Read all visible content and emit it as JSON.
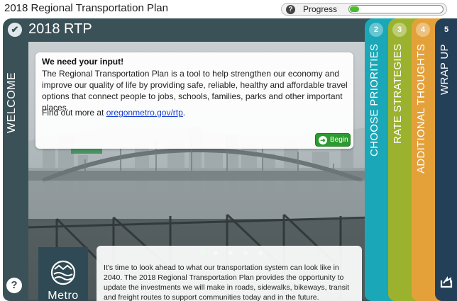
{
  "app": {
    "title": "2018 Regional Transportation Plan"
  },
  "progress": {
    "label": "Progress",
    "help_glyph": "?",
    "fraction": 0.1
  },
  "panel": {
    "title": "2018 RTP",
    "welcome_label": "WELCOME",
    "check_glyph": "✔",
    "help_glyph": "?"
  },
  "input_card": {
    "heading": "We need your input!",
    "body": "The Regional Transportation Plan is a tool to help strengthen our economy and improve our quality of life by providing safe, reliable, healthy and affordable travel options that connect people to jobs, schools, families, parks and other important places.",
    "find_out_prefix": "Find out more at ",
    "link_text": "oregonmetro.gov/rtp",
    "find_out_suffix": "."
  },
  "begin_button": {
    "label": "Begin",
    "icon": "arrow-right-icon"
  },
  "carousel": {
    "count": 5,
    "active_index": 0
  },
  "logo": {
    "text": "Metro"
  },
  "bottom_card": {
    "text": "It's time to look ahead to what our transportation system can look like in 2040. The 2018 Regional Transportation Plan provides the opportunity to update the investments we will make in roads, sidewalks, bikeways, transit and freight routes to support communities today and in the future."
  },
  "steps": [
    {
      "number": "2",
      "label": "CHOOSE PRIORITIES",
      "color": "#1aa7b7"
    },
    {
      "number": "3",
      "label": "RATE STRATEGIES",
      "color": "#9bb22f"
    },
    {
      "number": "4",
      "label": "ADDITIONAL THOUGHTS",
      "color": "#e4a13a"
    },
    {
      "number": "5",
      "label": "WRAP UP",
      "color": "#243f58"
    }
  ],
  "colors": {
    "panel": "#3a5157",
    "progress_fill": "#4cbb30",
    "begin": "#2d9a2f",
    "link": "#1a3fd1"
  }
}
